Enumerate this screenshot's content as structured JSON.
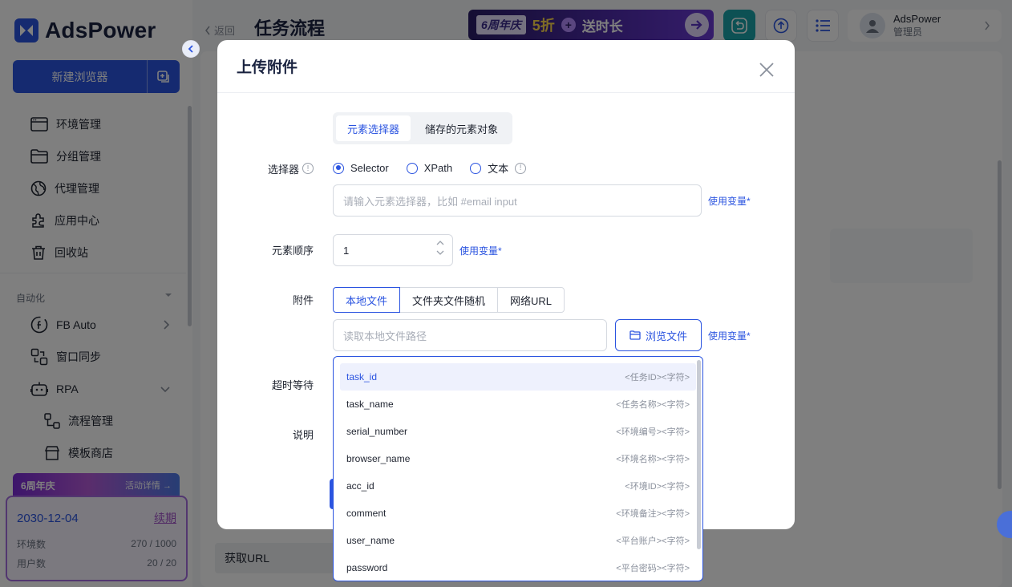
{
  "brand": {
    "name": "AdsPower",
    "accent": "#2b54e0"
  },
  "sidebar": {
    "new_browser_label": "新建浏览器",
    "items": [
      {
        "label": "环境管理",
        "icon": "browser-window-icon"
      },
      {
        "label": "分组管理",
        "icon": "folder-icon"
      },
      {
        "label": "代理管理",
        "icon": "globe-icon"
      },
      {
        "label": "应用中心",
        "icon": "puzzle-icon"
      },
      {
        "label": "回收站",
        "icon": "trash-icon"
      }
    ],
    "section_label": "自动化",
    "automation": [
      {
        "label": "FB Auto",
        "icon": "facebook-icon"
      },
      {
        "label": "窗口同步",
        "icon": "sync-windows-icon"
      },
      {
        "label": "RPA",
        "icon": "robot-icon"
      }
    ],
    "rpa_sub": [
      {
        "label": "流程管理",
        "icon": "flow-icon"
      },
      {
        "label": "模板商店",
        "icon": "store-icon"
      }
    ],
    "promo": {
      "title": "6周年庆",
      "link": "活动详情 →"
    },
    "plan": {
      "date": "2030-12-04",
      "renew": "续期",
      "env_label": "环境数",
      "env_value": "270 / 1000",
      "user_label": "用户数",
      "user_value": "20 / 20"
    }
  },
  "topbar": {
    "back_label": "返回",
    "title": "任务流程",
    "banner": {
      "tag": "6周年庆",
      "discount": "5折",
      "plus": "+",
      "text": "送时长"
    },
    "user": {
      "name": "AdsPower",
      "role": "管理员"
    }
  },
  "background": {
    "geturl_label": "获取URL"
  },
  "modal": {
    "title": "上传附件",
    "seg_tabs": [
      "元素选择器",
      "储存的元素对象"
    ],
    "selector_label": "选择器",
    "radio_options": [
      "Selector",
      "XPath",
      "文本"
    ],
    "selector_placeholder": "请输入元素选择器，比如 #email input",
    "use_var": "使用变量*",
    "order_label": "元素顺序",
    "order_value": "1",
    "attach_label": "附件",
    "attach_tabs": [
      "本地文件",
      "文件夹文件随机",
      "网络URL"
    ],
    "path_placeholder": "读取本地文件路径",
    "browse_label": "浏览文件",
    "timeout_label": "超时等待",
    "desc_label": "说明"
  },
  "dropdown": {
    "items": [
      {
        "name": "task_id",
        "desc": "<任务ID><字符>"
      },
      {
        "name": "task_name",
        "desc": "<任务名称><字符>"
      },
      {
        "name": "serial_number",
        "desc": "<环境编号><字符>"
      },
      {
        "name": "browser_name",
        "desc": "<环境名称><字符>"
      },
      {
        "name": "acc_id",
        "desc": "<环境ID><字符>"
      },
      {
        "name": "comment",
        "desc": "<环境备注><字符>"
      },
      {
        "name": "user_name",
        "desc": "<平台账户><字符>"
      },
      {
        "name": "password",
        "desc": "<平台密码><字符>"
      }
    ]
  }
}
